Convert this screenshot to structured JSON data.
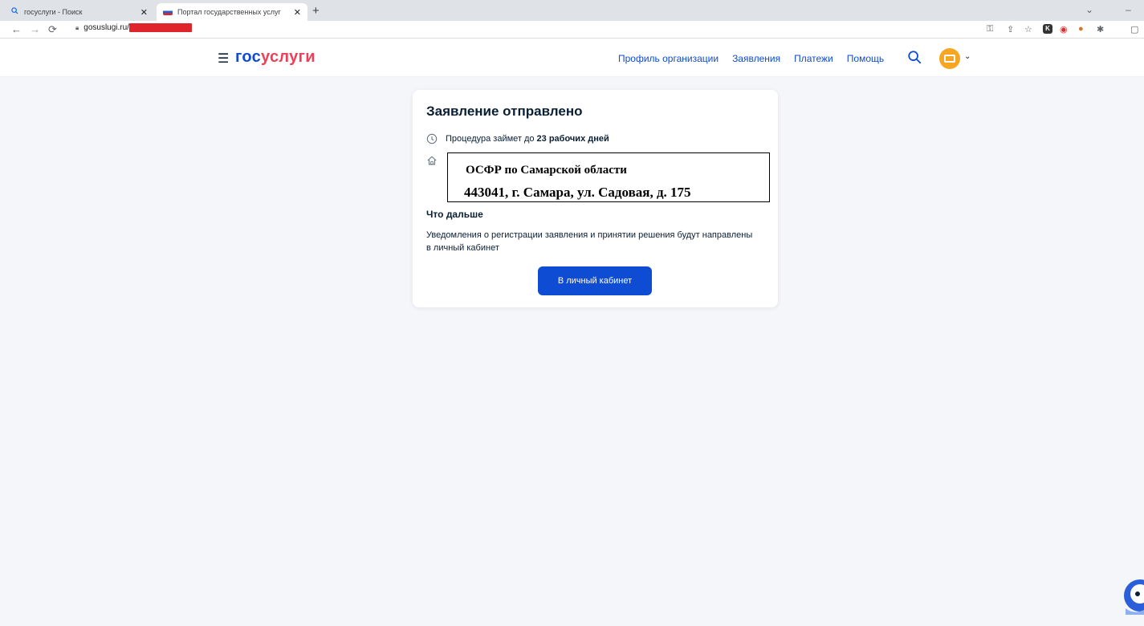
{
  "browser": {
    "tabs": [
      {
        "title": "госуслуги - Поиск",
        "icon": "search-icon"
      },
      {
        "title": "Портал государственных услуг",
        "icon": "flag-icon"
      }
    ],
    "new_tab": "+",
    "url": "gosuslugi.ru/",
    "redaction_color": "#e0242c"
  },
  "header": {
    "logo_part1": "гос",
    "logo_part2": "услуги",
    "nav": [
      "Профиль организации",
      "Заявления",
      "Платежи",
      "Помощь"
    ]
  },
  "card": {
    "title": "Заявление отправлено",
    "duration_prefix": "Процедура займет до",
    "duration_value": "23 рабочих дней",
    "office_name": "ОСФР по Самарской области",
    "office_address": "443041, г. Самара, ул. Садовая, д. 175",
    "next_title": "Что дальше",
    "next_text": "Уведомления о регистрации заявления и принятии решения будут направлены в личный кабинет",
    "button": "В личный кабинет"
  },
  "colors": {
    "brand_blue": "#0d4cd3",
    "brand_red": "#ee3f58",
    "avatar": "#f6a623",
    "page_bg": "#f4f6f9"
  }
}
